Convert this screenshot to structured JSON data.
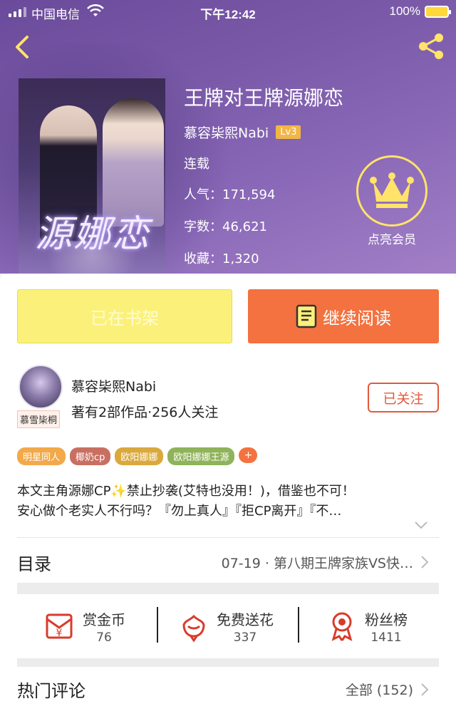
{
  "status_bar": {
    "carrier": "中国电信",
    "time": "下午12:42",
    "battery": "100%"
  },
  "book": {
    "title": "王牌对王牌源娜恋",
    "cover_title": "源娜恋",
    "author": "慕容枈熙Nabi",
    "author_level": "Lv3",
    "status": "连载",
    "popularity": "人气：171,594",
    "word_count": "字数：46,621",
    "favorites": "收藏：1,320"
  },
  "vip": {
    "label": "点亮会员"
  },
  "actions": {
    "shelf_label": "已在书架",
    "read_label": "继续阅读"
  },
  "author_info": {
    "name": "慕容枈熙Nabi",
    "avatar_tag": "慕雪枈桐",
    "meta": "著有2部作品·256人关注",
    "follow_label": "已关注"
  },
  "tags": [
    {
      "label": "明星同人",
      "color": "#f2a94a"
    },
    {
      "label": "椰奶cp",
      "color": "#c96f62"
    },
    {
      "label": "欧阳娜娜",
      "color": "#d9a93e"
    },
    {
      "label": "欧阳娜娜王源",
      "color": "#8fb35a"
    }
  ],
  "tag_more": "+",
  "intro": {
    "line1": "本文主角源娜CP✨禁止抄袭(艾特也没用！)，借鉴也不可！",
    "line2": "安心做个老实人不行吗？『勿上真人』『拒CP离开』『不…"
  },
  "toc": {
    "label": "目录",
    "latest": "07-19 · 第八期王牌家族VS快…"
  },
  "stats": [
    {
      "label": "赏金币",
      "value": "76",
      "icon": "coin-envelope-icon"
    },
    {
      "label": "免费送花",
      "value": "337",
      "icon": "flower-icon"
    },
    {
      "label": "粉丝榜",
      "value": "1411",
      "icon": "medal-icon"
    }
  ],
  "comments": {
    "label": "热门评论",
    "all": "全部 (152)"
  },
  "colors": {
    "header_purple": "#7a5aa8",
    "shelf_yellow": "#fbf17a",
    "read_orange": "#f3723f",
    "follow_red": "#e05a3c",
    "crown_yellow": "#ffe36b"
  }
}
